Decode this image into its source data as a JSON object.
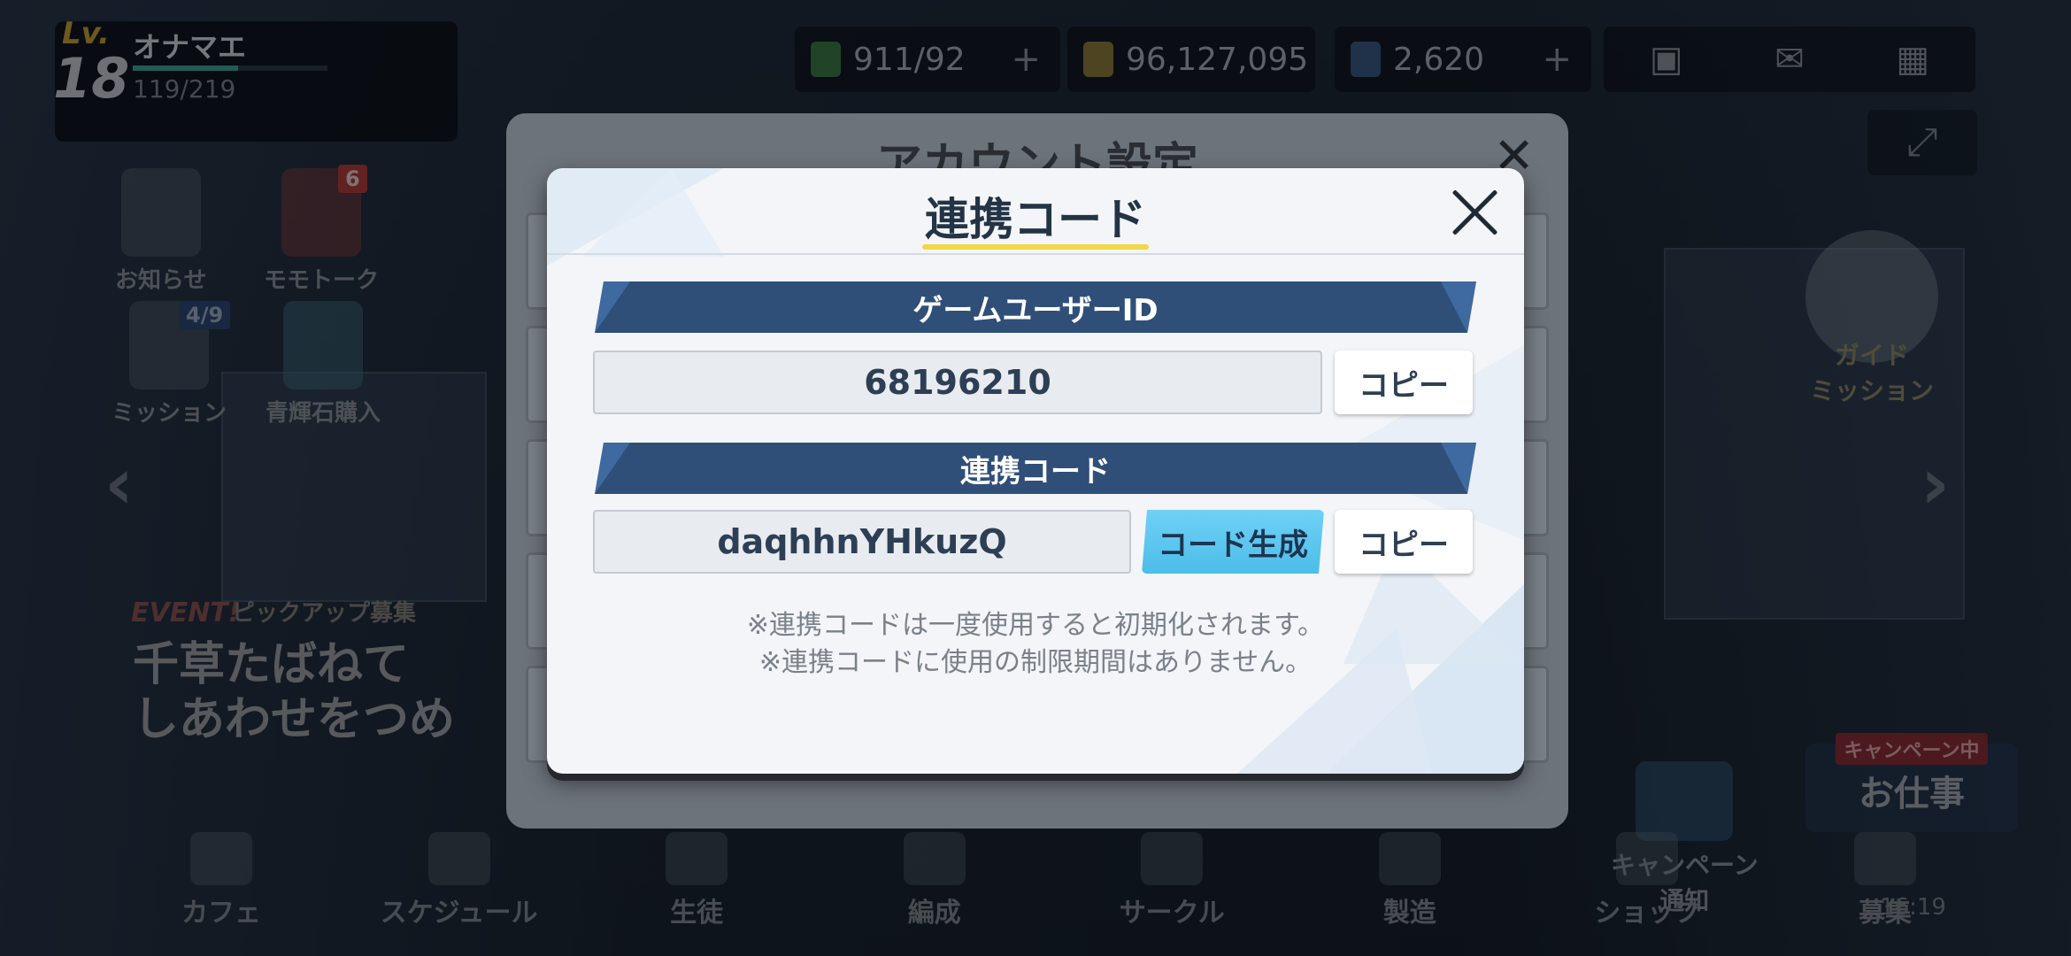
{
  "player": {
    "lv_label": "Lv.",
    "level": "18",
    "name": "オナマエ",
    "exp_text": "119/219",
    "exp_fraction": 0.54
  },
  "resources": {
    "ap": "911/92",
    "credits": "96,127,095",
    "pyroxene": "2,620",
    "plus": "+"
  },
  "left_menu": {
    "notice": "お知らせ",
    "momotalk": "モモトーク",
    "momotalk_badge": "6",
    "mission": "ミッション",
    "mission_badge": "4/9",
    "pyroxene_shop": "青輝石購入"
  },
  "event_banner": {
    "tag": "EVENT!",
    "sub": "ピックアップ募集",
    "title_line1": "千草たばねて",
    "title_line2": "しあわせをつめ"
  },
  "guide": {
    "label": "ガイド\nミッション"
  },
  "campaign": {
    "label_line1": "キャンペーン",
    "label_line2": "通知"
  },
  "work": {
    "tag": "キャンペーン中",
    "label": "お仕事"
  },
  "bottom_nav": [
    "カフェ",
    "スケジュール",
    "生徒",
    "編成",
    "サークル",
    "製造",
    "ショップ",
    "募集"
  ],
  "clock": "16:19",
  "account_modal": {
    "title": "アカウント設定",
    "close": "✕"
  },
  "link_modal": {
    "title": "連携コード",
    "user_id_header": "ゲームユーザーID",
    "user_id_value": "68196210",
    "copy_label": "コピー",
    "code_header": "連携コード",
    "code_value": "daqhhnYHkuzQ",
    "generate_label": "コード生成",
    "note1": "※連携コードは一度使用すると初期化されます。",
    "note2": "※連携コードに使用の制限期間はありません。"
  },
  "colors": {
    "header_bar": "#2f4f79",
    "generate_button": "#5cc6ee",
    "title_underline": "#f2d747"
  }
}
